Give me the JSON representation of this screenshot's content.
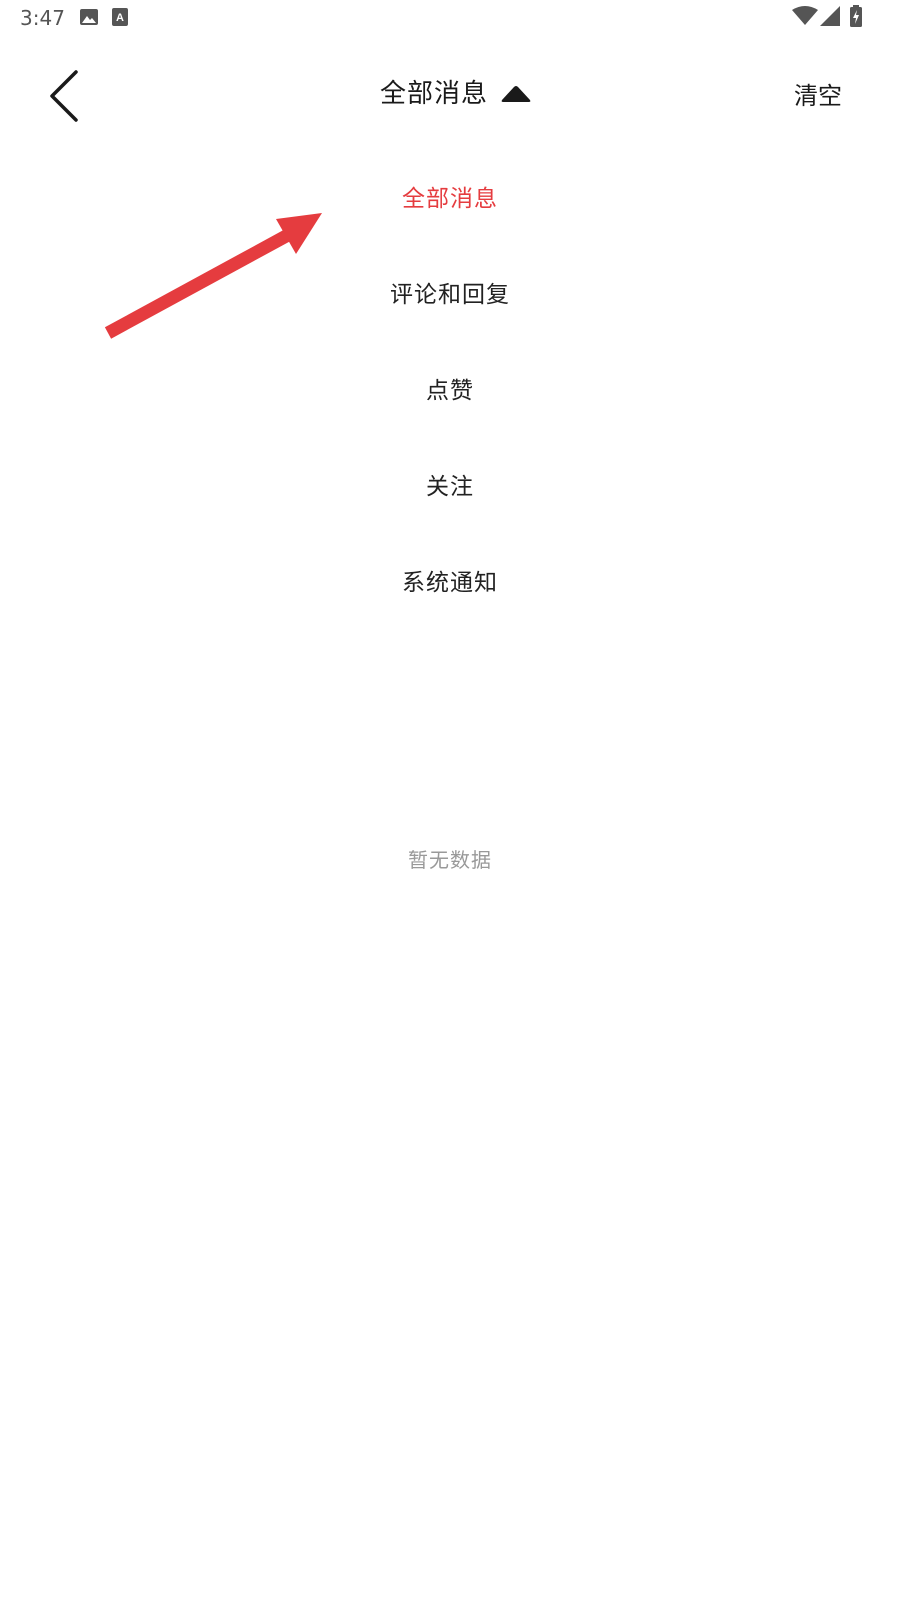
{
  "status_bar": {
    "time": "3:47",
    "icons": [
      "image-icon",
      "a-icon",
      "wifi-icon",
      "signal-icon",
      "battery-icon"
    ]
  },
  "nav": {
    "back_icon": "chevron-left-icon",
    "title": "全部消息",
    "title_caret_icon": "caret-up-icon",
    "clear_label": "清空"
  },
  "filter_menu": {
    "items": [
      {
        "label": "全部消息",
        "selected": true
      },
      {
        "label": "评论和回复",
        "selected": false
      },
      {
        "label": "点赞",
        "selected": false
      },
      {
        "label": "关注",
        "selected": false
      },
      {
        "label": "系统通知",
        "selected": false
      }
    ]
  },
  "annotation": {
    "icon": "red-arrow-icon",
    "color": "#e53c3f"
  },
  "empty_state": {
    "text": "暂无数据"
  },
  "colors": {
    "accent": "#e53c3f",
    "text_primary": "#222222",
    "text_muted": "#999999",
    "background": "#ffffff"
  }
}
